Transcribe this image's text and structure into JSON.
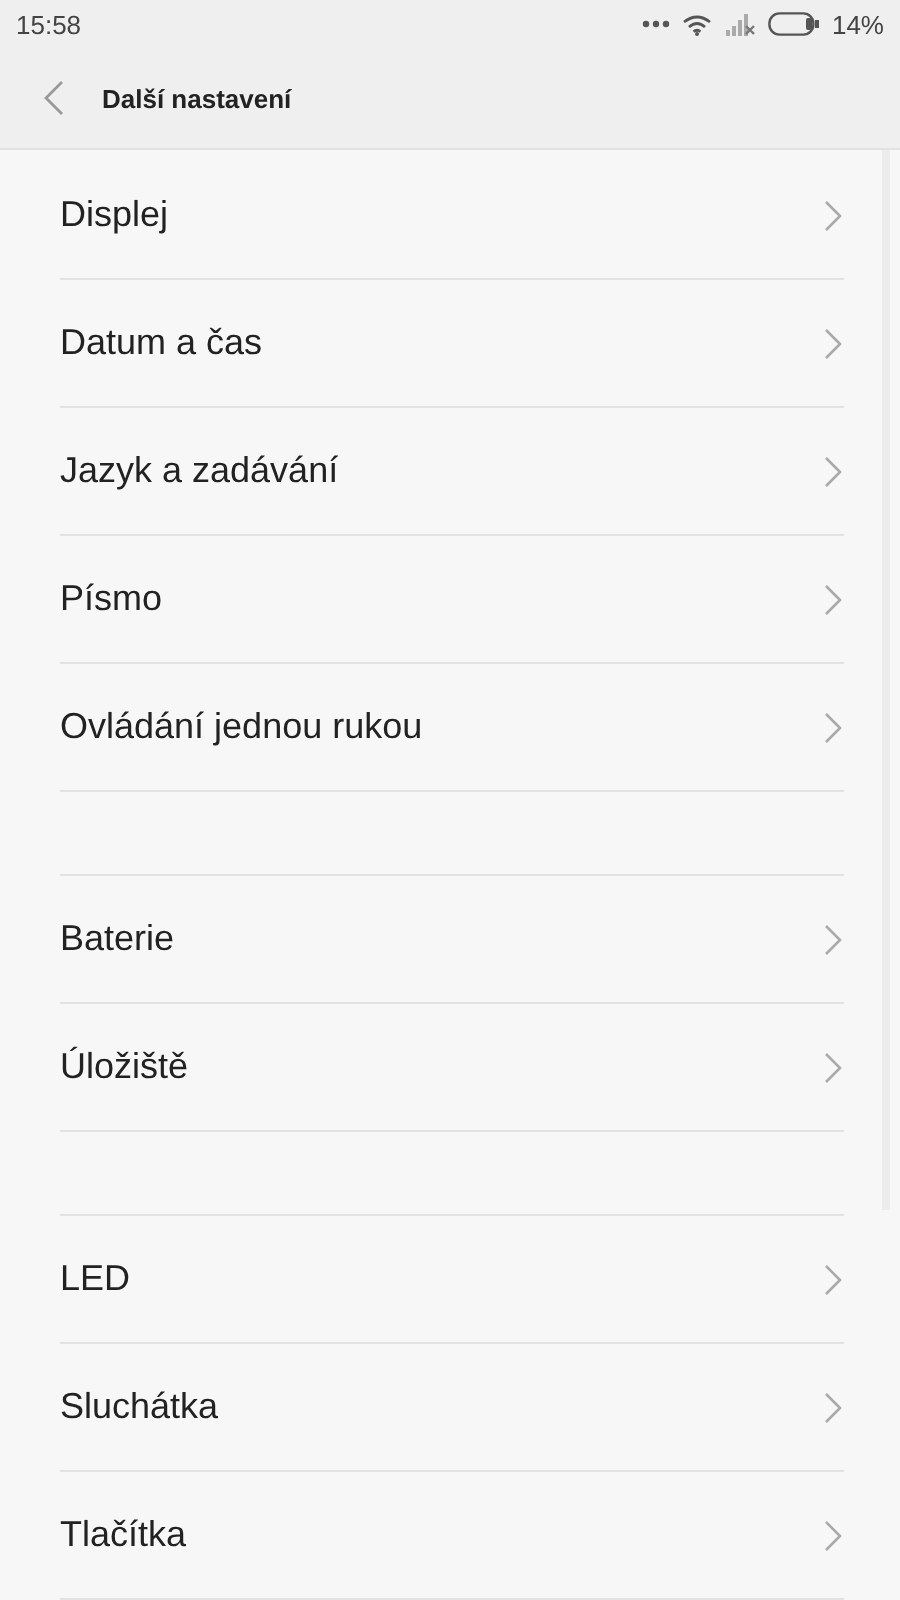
{
  "status_bar": {
    "time": "15:58",
    "battery": "14%"
  },
  "header": {
    "title": "Další nastavení"
  },
  "groups": [
    {
      "items": [
        "Displej",
        "Datum a čas",
        "Jazyk a zadávání",
        "Písmo",
        "Ovládání jednou rukou"
      ]
    },
    {
      "items": [
        "Baterie",
        "Úložiště"
      ]
    },
    {
      "items": [
        "LED",
        "Sluchátka",
        "Tlačítka"
      ]
    }
  ]
}
